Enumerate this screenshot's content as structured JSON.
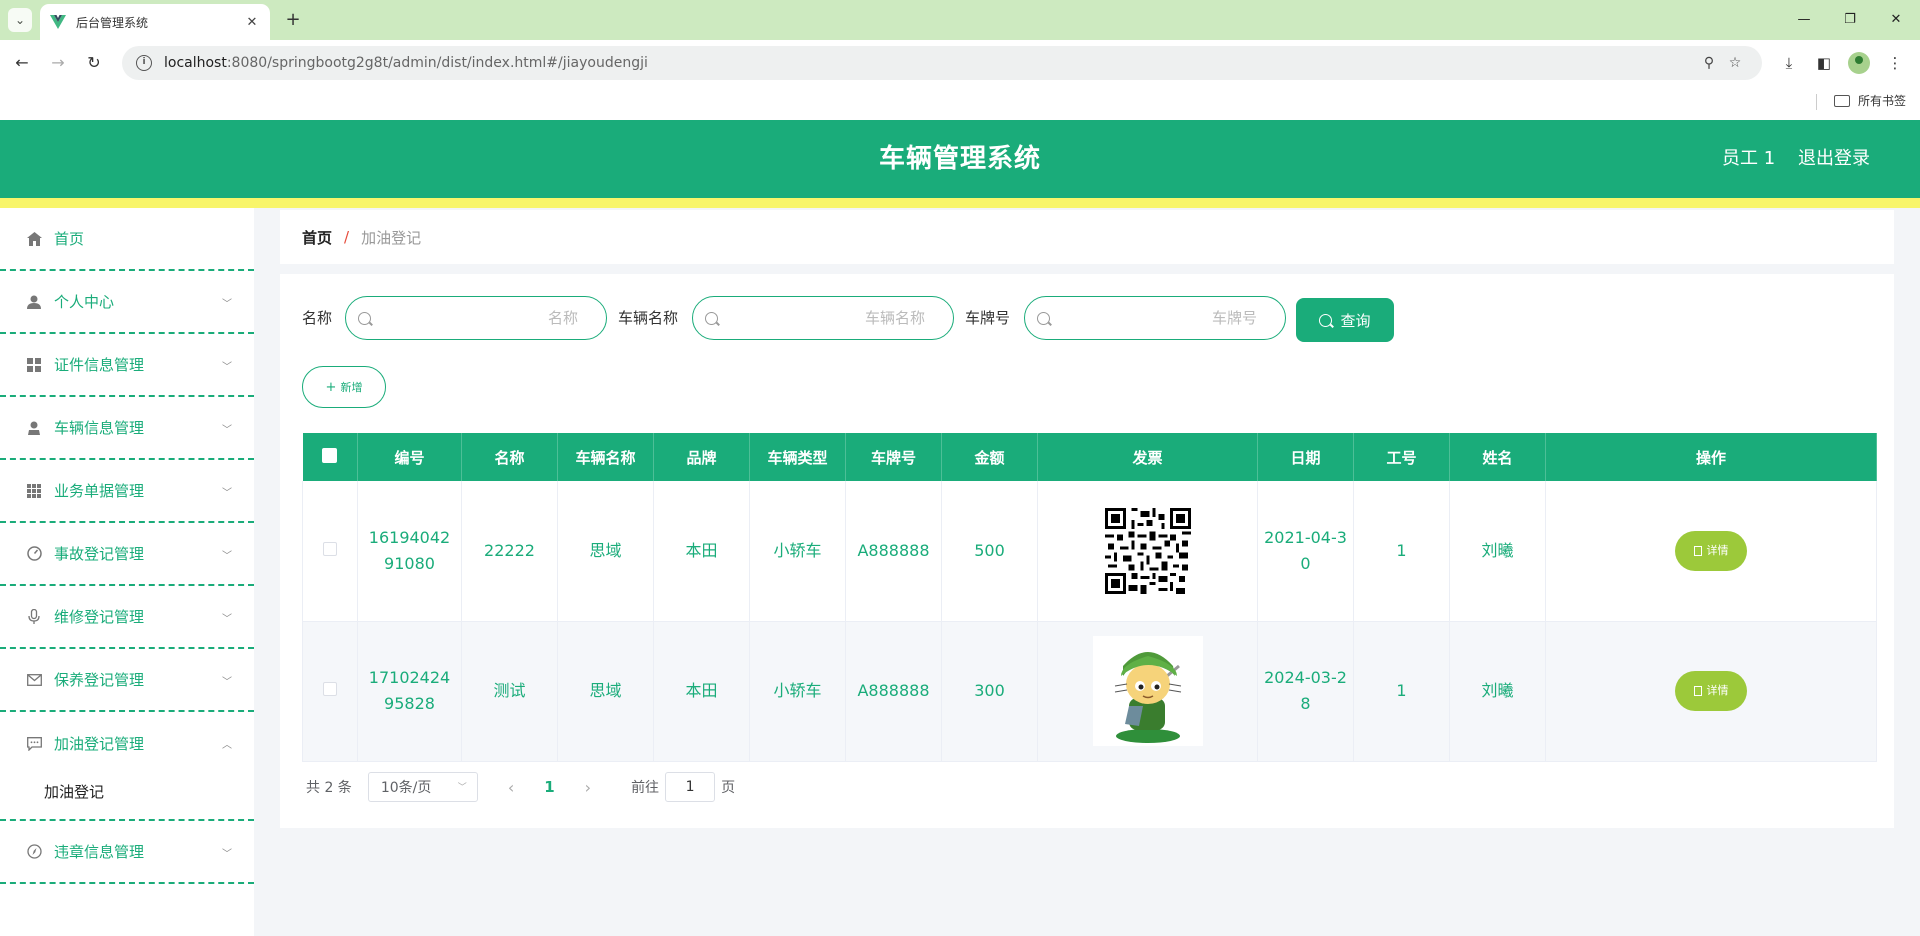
{
  "browser": {
    "tab_title": "后台管理系统",
    "url_host": "localhost",
    "url_rest": ":8080/springbootg2g8t/admin/dist/index.html#/jiayoudengji",
    "bookmark_folder": "所有书签"
  },
  "header": {
    "title": "车辆管理系统",
    "user": "员工 1",
    "logout": "退出登录"
  },
  "sidebar": {
    "items": [
      {
        "label": "首页",
        "icon": "home-icon"
      },
      {
        "label": "个人中心",
        "icon": "user-icon"
      },
      {
        "label": "证件信息管理",
        "icon": "grid-icon"
      },
      {
        "label": "车辆信息管理",
        "icon": "user-icon"
      },
      {
        "label": "业务单据管理",
        "icon": "grid-icon"
      },
      {
        "label": "事故登记管理",
        "icon": "gauge-icon"
      },
      {
        "label": "维修登记管理",
        "icon": "mic-icon"
      },
      {
        "label": "保养登记管理",
        "icon": "mail-icon"
      },
      {
        "label": "加油登记管理",
        "icon": "chat-icon"
      },
      {
        "label": "违章信息管理",
        "icon": "compass-icon"
      }
    ],
    "sub_item": "加油登记"
  },
  "breadcrumb": {
    "home": "首页",
    "separator": "/",
    "current": "加油登记"
  },
  "search": {
    "name_label": "名称",
    "name_placeholder": "名称",
    "vehicle_label": "车辆名称",
    "vehicle_placeholder": "车辆名称",
    "plate_label": "车牌号",
    "plate_placeholder": "车牌号",
    "query_label": "查询",
    "add_label": "新增"
  },
  "table": {
    "columns": [
      "编号",
      "名称",
      "车辆名称",
      "品牌",
      "车辆类型",
      "车牌号",
      "金额",
      "发票",
      "日期",
      "工号",
      "姓名",
      "操作"
    ],
    "rows": [
      {
        "id": "1619404291080",
        "name": "22222",
        "vehicle": "思域",
        "brand": "本田",
        "type": "小轿车",
        "plate": "A888888",
        "amount": "500",
        "invoice": "qr-code-image",
        "date": "2021-04-30",
        "worker_no": "1",
        "person": "刘曦",
        "action": "详情"
      },
      {
        "id": "1710242495828",
        "name": "测试",
        "vehicle": "思域",
        "brand": "本田",
        "type": "小轿车",
        "plate": "A888888",
        "amount": "300",
        "invoice": "cartoon-avatar-image",
        "date": "2024-03-28",
        "worker_no": "1",
        "person": "刘曦",
        "action": "详情"
      }
    ]
  },
  "pagination": {
    "total": "共 2 条",
    "page_size": "10条/页",
    "current": "1",
    "goto": "前往",
    "goto_value": "1",
    "page_unit": "页"
  },
  "colors": {
    "primary": "#1aac7a",
    "accent_bar": "#f8f56a",
    "detail_button": "#9cc93a"
  }
}
